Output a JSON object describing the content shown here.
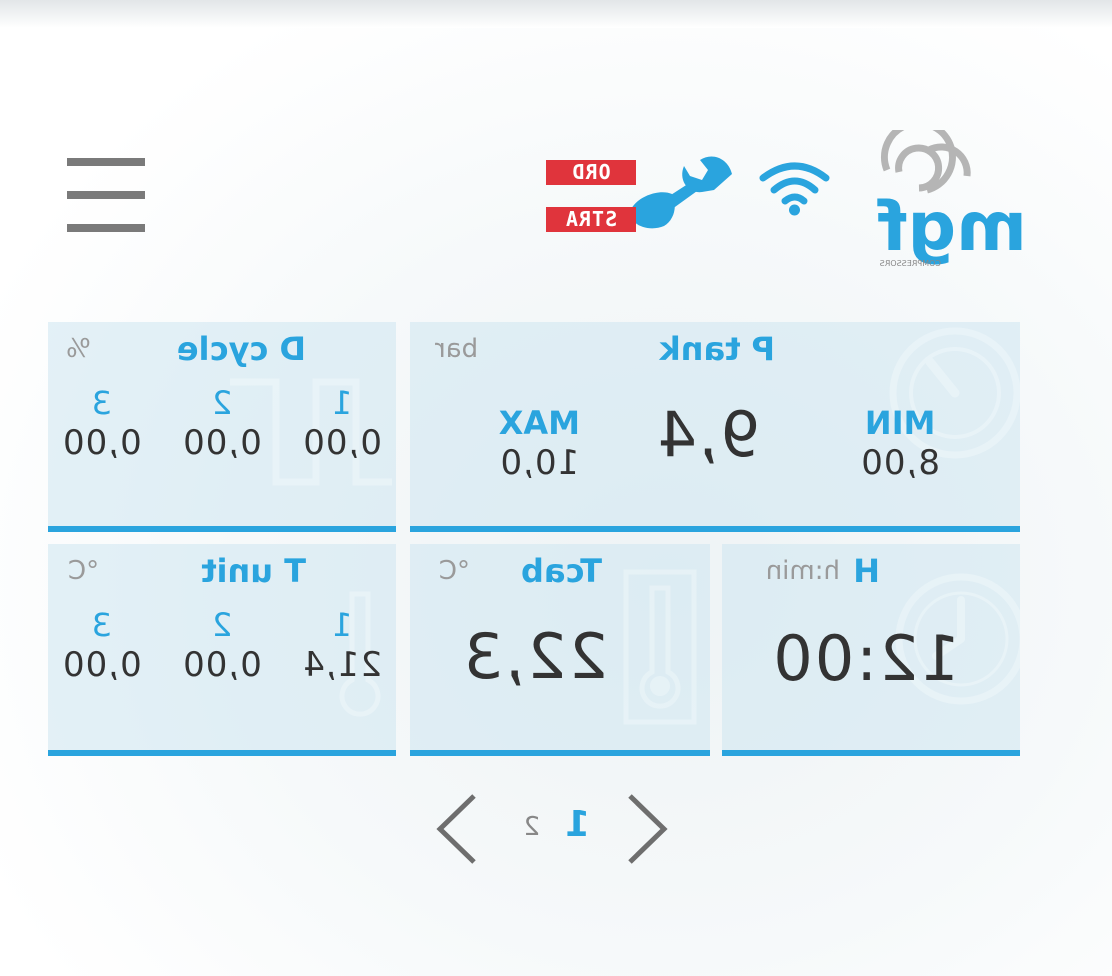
{
  "header": {
    "logo_text": "mgf",
    "logo_subtext": "COMPRESSORS",
    "status_tags": [
      "ORD",
      "STRA"
    ],
    "accent_color": "#2aa4de",
    "tag_color": "#e0343c"
  },
  "cards": {
    "p_tank": {
      "title": "P tank",
      "unit": "bar",
      "min_label": "MIN",
      "min_value": "8,00",
      "max_label": "MAX",
      "max_value": "10,0",
      "current_value": "9,4"
    },
    "d_cycle": {
      "title": "D cycle",
      "unit": "%",
      "columns": [
        {
          "label": "1",
          "value": "0,00"
        },
        {
          "label": "2",
          "value": "0,00"
        },
        {
          "label": "3",
          "value": "0,00"
        }
      ]
    },
    "hour": {
      "title": "H",
      "unit": "h:min",
      "value": "12:00"
    },
    "t_cab": {
      "title": "Tcab",
      "unit": "°C",
      "value": "22,3"
    },
    "t_unit": {
      "title": "T unit",
      "unit": "°C",
      "columns": [
        {
          "label": "1",
          "value": "21,4"
        },
        {
          "label": "2",
          "value": "0,00"
        },
        {
          "label": "3",
          "value": "0,00"
        }
      ]
    }
  },
  "pagination": {
    "pages": [
      "1",
      "2"
    ],
    "current": "1"
  }
}
